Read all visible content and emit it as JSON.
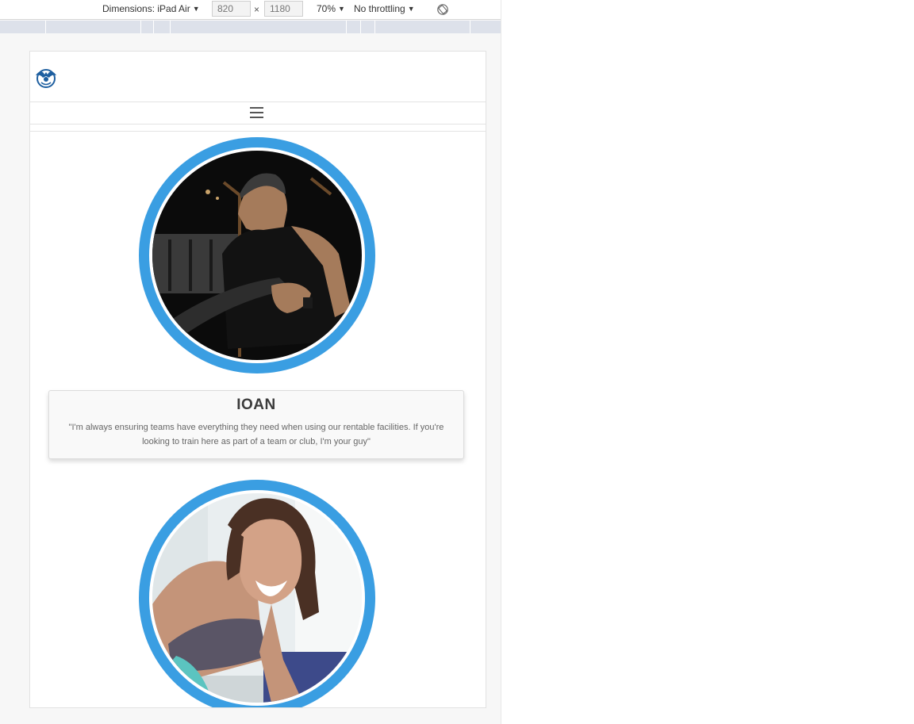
{
  "devtools": {
    "dimensions_label": "Dimensions: iPad Air",
    "width_value": "820",
    "times_sign": "×",
    "height_value": "1180",
    "zoom_label": "70%",
    "throttling_label": "No throttling"
  },
  "icons": {
    "logo": "club-logo-icon",
    "menu": "hamburger-menu-icon",
    "rotate": "rotate-device-icon",
    "dropdown": "caret-down-icon"
  },
  "trainers": [
    {
      "name": "IOAN",
      "quote": "\"I'm always ensuring teams have everything they need when using our rentable facilities. If you're looking to train here as part of a team or club, I'm your guy\""
    }
  ],
  "colors": {
    "ring_accent": "#3a9ee2",
    "card_background": "#f9f9f9",
    "ruler_bar": "#dde1ea"
  }
}
